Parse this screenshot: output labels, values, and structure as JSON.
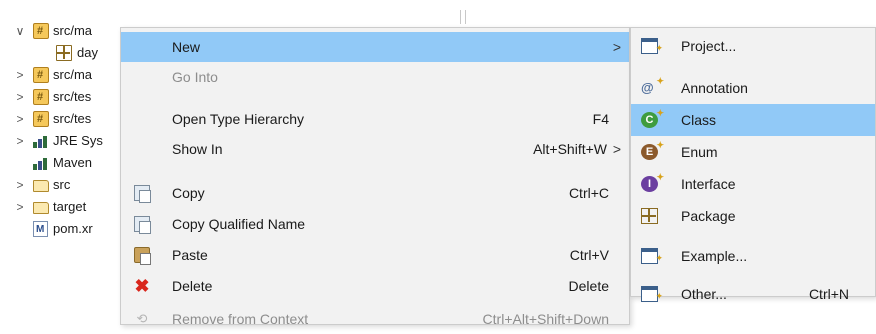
{
  "tree": {
    "items": [
      {
        "label": "src/ma",
        "icon": "package-folder-icon",
        "expanded": true
      },
      {
        "label": "day",
        "icon": "package-icon"
      },
      {
        "label": "src/ma",
        "icon": "package-folder-icon"
      },
      {
        "label": "src/tes",
        "icon": "package-folder-icon"
      },
      {
        "label": "src/tes",
        "icon": "package-folder-icon"
      },
      {
        "label": "JRE Sys",
        "icon": "library-icon"
      },
      {
        "label": "Maven",
        "icon": "library-icon"
      },
      {
        "label": "src",
        "icon": "folder-icon"
      },
      {
        "label": "target",
        "icon": "folder-icon"
      },
      {
        "label": "pom.xr",
        "icon": "maven-file-icon"
      }
    ],
    "chevron_expanded": "∨",
    "chevron_collapsed": ">"
  },
  "context_menu": {
    "items": [
      {
        "label": "New",
        "shortcut": "",
        "arrow": ">",
        "highlighted": true
      },
      {
        "label": "Go Into",
        "disabled": true
      },
      {
        "label": "Open Type Hierarchy",
        "shortcut": "F4"
      },
      {
        "label": "Show In",
        "shortcut": "Alt+Shift+W",
        "arrow": ">"
      },
      {
        "label": "Copy",
        "shortcut": "Ctrl+C",
        "icon": "copy-icon"
      },
      {
        "label": "Copy Qualified Name",
        "icon": "copy-qualified-name-icon"
      },
      {
        "label": "Paste",
        "shortcut": "Ctrl+V",
        "icon": "paste-icon"
      },
      {
        "label": "Delete",
        "shortcut": "Delete",
        "icon": "delete-icon"
      },
      {
        "label": "Remove from Context",
        "shortcut": "Ctrl+Alt+Shift+Down",
        "icon": "remove-from-context-icon",
        "disabled": true
      }
    ]
  },
  "submenu": {
    "items": [
      {
        "label": "Project...",
        "icon": "project-wizard-icon"
      },
      {
        "label": "Annotation",
        "icon": "annotation-icon"
      },
      {
        "label": "Class",
        "icon": "class-icon",
        "highlighted": true
      },
      {
        "label": "Enum",
        "icon": "enum-icon"
      },
      {
        "label": "Interface",
        "icon": "interface-icon"
      },
      {
        "label": "Package",
        "icon": "package-icon"
      },
      {
        "label": "Example...",
        "icon": "example-wizard-icon"
      },
      {
        "label": "Other...",
        "shortcut": "Ctrl+N",
        "icon": "other-wizard-icon"
      }
    ],
    "glyphs": {
      "annotation": "@",
      "class": "C",
      "enum": "E",
      "interface": "I"
    }
  },
  "colors": {
    "highlight": "#91c9f7",
    "menu_background": "#f2f2f2",
    "disabled_text": "#8d8d8d",
    "delete_red": "#d9261c"
  }
}
